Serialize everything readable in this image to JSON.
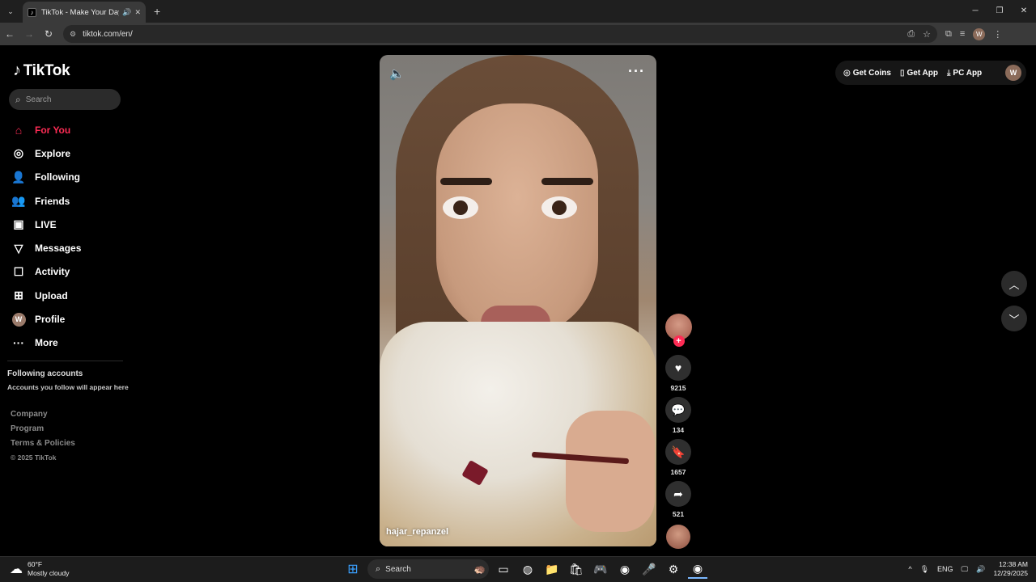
{
  "browser": {
    "tab_title": "TikTok - Make Your Day",
    "url": "tiktok.com/en/",
    "profile_initial": "W",
    "icons": [
      "tab-list-icon",
      "speaker-icon",
      "close-icon",
      "plus-icon",
      "minimize-icon",
      "maximize-icon",
      "back-icon",
      "forward-icon",
      "reload-icon",
      "site-info-icon",
      "install-app-icon",
      "star-icon",
      "extensions-icon",
      "media-controls-icon",
      "kebab-menu-icon"
    ]
  },
  "sidebar": {
    "logo_text": "TikTok",
    "search_placeholder": "Search",
    "items": [
      {
        "label": "For You",
        "icon": "home-icon"
      },
      {
        "label": "Explore",
        "icon": "compass-icon"
      },
      {
        "label": "Following",
        "icon": "user-follow-icon"
      },
      {
        "label": "Friends",
        "icon": "friends-icon"
      },
      {
        "label": "LIVE",
        "icon": "live-icon"
      },
      {
        "label": "Messages",
        "icon": "send-icon"
      },
      {
        "label": "Activity",
        "icon": "activity-icon"
      },
      {
        "label": "Upload",
        "icon": "upload-icon"
      },
      {
        "label": "Profile",
        "icon": "avatar",
        "initial": "W"
      },
      {
        "label": "More",
        "icon": "ellipsis-icon"
      }
    ],
    "following_title": "Following accounts",
    "following_sub": "Accounts you follow will appear here",
    "footer": [
      "Company",
      "Program",
      "Terms & Policies",
      "© 2025 TikTok"
    ],
    "active_color": "#fe2c55"
  },
  "video": {
    "author": "hajar_repanzel",
    "likes": "9215",
    "comments": "134",
    "saves": "1657",
    "shares": "521"
  },
  "topbar": {
    "get_coins": "Get Coins",
    "get_app": "Get App",
    "pc_app": "PC App",
    "avatar_initial": "W"
  },
  "taskbar": {
    "temperature": "60°F",
    "weather_desc": "Mostly cloudy",
    "search_label": "Search",
    "language": "ENG",
    "time": "12:38 AM",
    "date": "12/29/2025"
  }
}
